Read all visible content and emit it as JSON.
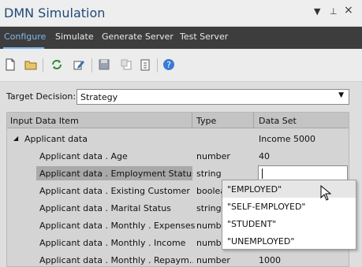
{
  "window": {
    "title": "DMN Simulation",
    "controls": {
      "dropdown": "▼",
      "pin": "⊥",
      "close": "×"
    }
  },
  "tabs": [
    {
      "label": "Configure",
      "active": true
    },
    {
      "label": "Simulate"
    },
    {
      "label": "Generate Server"
    },
    {
      "label": "Test Server"
    }
  ],
  "toolbar": {
    "icons": [
      "new-document-icon",
      "open-folder-icon",
      "refresh-icon",
      "edit-icon",
      "save-icon",
      "copy-icon",
      "paste-icon",
      "help-icon"
    ]
  },
  "target": {
    "label": "Target Decision:",
    "value": "Strategy"
  },
  "grid": {
    "headers": {
      "item": "Input Data Item",
      "type": "Type",
      "dataset": "Data Set"
    },
    "group": {
      "label": "Applicant data",
      "value": "Income 5000"
    },
    "rows": [
      {
        "item": "Applicant data . Age",
        "type": "number",
        "value": "40"
      },
      {
        "item": "Applicant data . Employment Status",
        "type": "string",
        "value": ""
      },
      {
        "item": "Applicant data . Existing Customer",
        "type": "boolea",
        "value": ""
      },
      {
        "item": "Applicant data . Marital Status",
        "type": "string",
        "value": ""
      },
      {
        "item": "Applicant data . Monthly . Expenses",
        "type": "numb",
        "value": ""
      },
      {
        "item": "Applicant data . Monthly . Income",
        "type": "numb",
        "value": ""
      },
      {
        "item": "Applicant data . Monthly . Repaym...",
        "type": "number",
        "value": "1000"
      }
    ]
  },
  "dropdown": {
    "options": [
      "\"EMPLOYED\"",
      "\"SELF-EMPLOYED\"",
      "\"STUDENT\"",
      "\"UNEMPLOYED\""
    ],
    "hovered_index": 0
  },
  "colors": {
    "accent": "#7fb6ef",
    "title": "#1f4a7a",
    "tabbar": "#3d3d3d",
    "selected_row": "#a9a9a9"
  }
}
